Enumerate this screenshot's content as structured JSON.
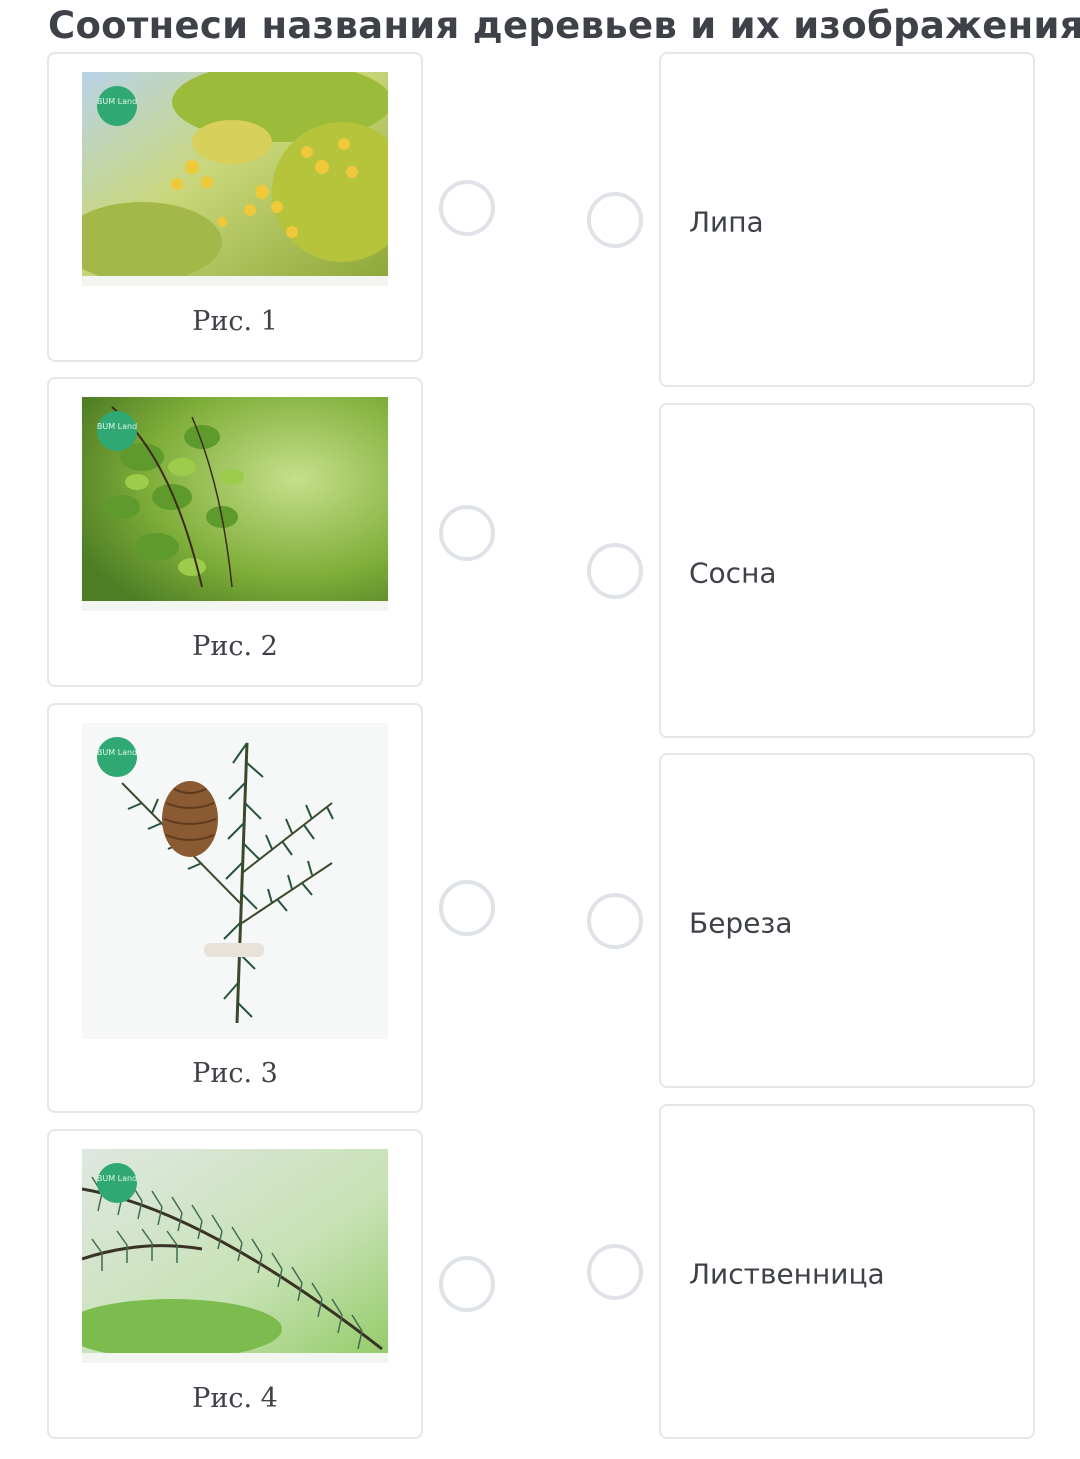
{
  "title": "Соотнеси названия деревьев и их изображения.",
  "watermark": "BUM Land",
  "images": [
    {
      "caption": "Рис. 1",
      "icon": "linden-blossom-photo"
    },
    {
      "caption": "Рис. 2",
      "icon": "birch-leaves-photo"
    },
    {
      "caption": "Рис. 3",
      "icon": "pine-branch-cone-photo"
    },
    {
      "caption": "Рис. 4",
      "icon": "larch-branch-photo"
    }
  ],
  "names": [
    {
      "label": "Липа"
    },
    {
      "label": "Сосна"
    },
    {
      "label": "Береза"
    },
    {
      "label": "Лиственница"
    }
  ]
}
